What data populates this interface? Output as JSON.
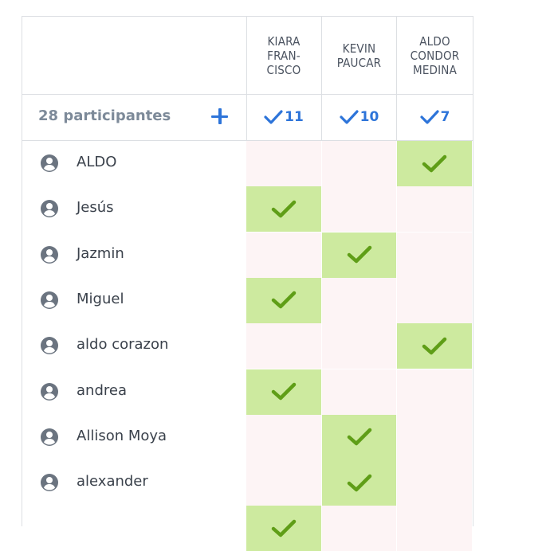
{
  "columns": [
    {
      "label": "KIARA FRAN- CISCO",
      "count": "11"
    },
    {
      "label": "KEVIN PAUCAR",
      "count": "10"
    },
    {
      "label": "ALDO CONDOR MEDINA",
      "count": "7"
    }
  ],
  "summary": {
    "participants": "28 participantes"
  },
  "rows": [
    {
      "name": "ALDO",
      "votes": [
        false,
        false,
        true
      ]
    },
    {
      "name": "Jesús",
      "votes": [
        true,
        false,
        false
      ]
    },
    {
      "name": "Jazmin",
      "votes": [
        false,
        true,
        false
      ]
    },
    {
      "name": "Miguel",
      "votes": [
        true,
        false,
        false
      ]
    },
    {
      "name": "aldo corazon",
      "votes": [
        false,
        false,
        true
      ]
    },
    {
      "name": "andrea",
      "votes": [
        true,
        false,
        false
      ]
    },
    {
      "name": "Allison Moya",
      "votes": [
        false,
        true,
        false
      ]
    },
    {
      "name": "alexander",
      "votes": [
        false,
        true,
        false
      ]
    },
    {
      "name": "",
      "votes": [
        true,
        false,
        false
      ]
    }
  ],
  "colors": {
    "accent": "#2d74d9",
    "yes": "#cdea9f",
    "no": "#fdf4f5",
    "check": "#5f9e17"
  },
  "icons": {
    "add": "plus-icon",
    "check": "check-icon",
    "user": "user-circle-icon"
  }
}
